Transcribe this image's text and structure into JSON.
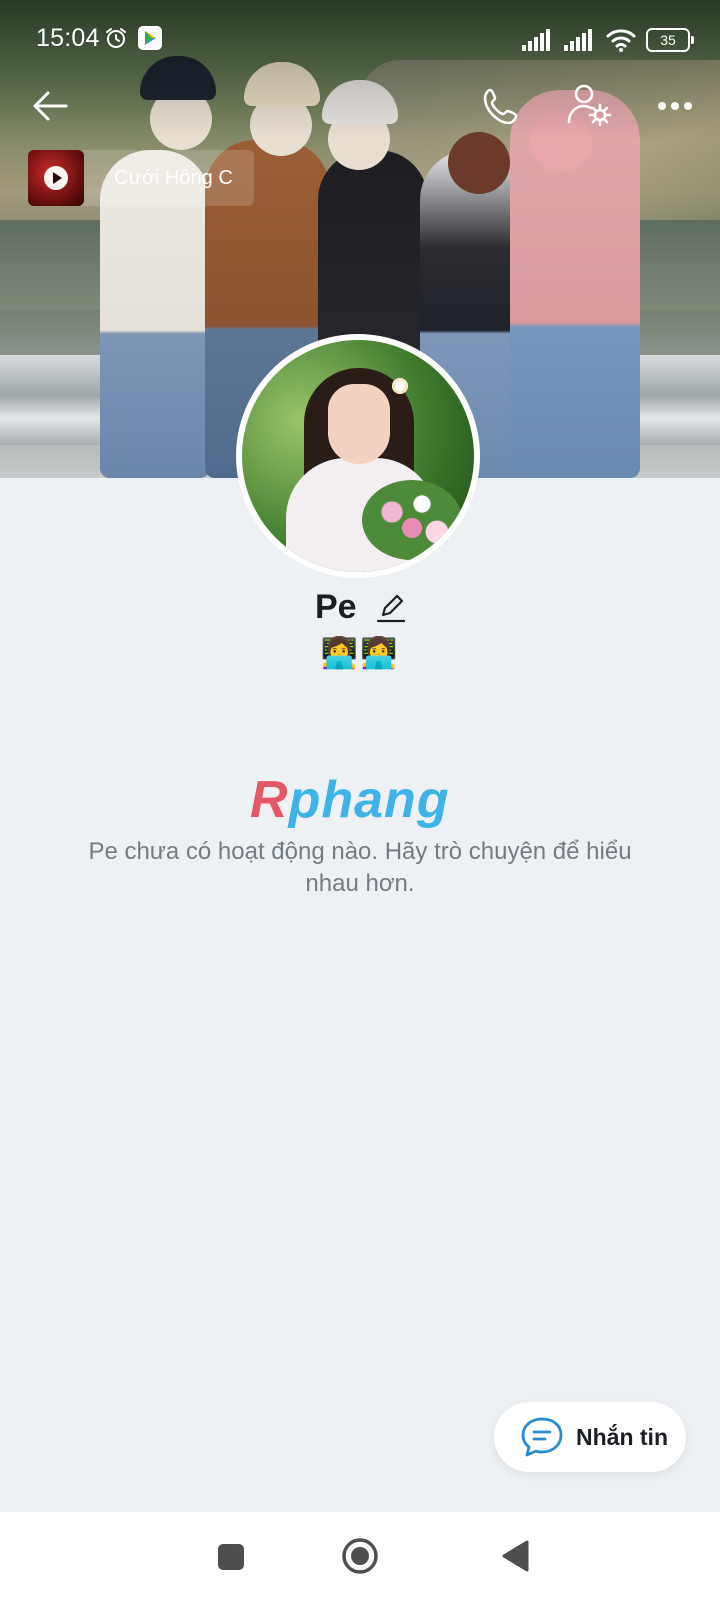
{
  "status_bar": {
    "time": "15:04",
    "battery": "35",
    "icons": [
      "alarm-icon",
      "play-store-icon",
      "signal-icon",
      "signal-icon",
      "wifi-icon",
      "battery-icon"
    ]
  },
  "top_bar": {
    "icons": [
      "back-arrow-icon",
      "phone-icon",
      "user-settings-icon",
      "more-dots-icon"
    ]
  },
  "music": {
    "title": "Cưới Hông C",
    "icon": "play-icon"
  },
  "profile": {
    "name": "Pe",
    "bio": "👩‍💻👩‍💻",
    "edit_icon": "pencil-icon"
  },
  "watermark": {
    "first": "R",
    "rest": "phang"
  },
  "empty_state": {
    "message": "Pe chưa có hoạt động nào. Hãy trò chuyện để hiểu nhau hơn."
  },
  "actions": {
    "message_label": "Nhắn tin",
    "message_icon": "chat-bubble-icon"
  },
  "system_nav": {
    "icons": [
      "recents-square-icon",
      "home-circle-icon",
      "back-triangle-icon"
    ]
  },
  "colors": {
    "background": "#eef1f4",
    "accent": "#2a8bd0",
    "watermark_red": "#e45865",
    "watermark_blue": "#3fb2e6"
  }
}
